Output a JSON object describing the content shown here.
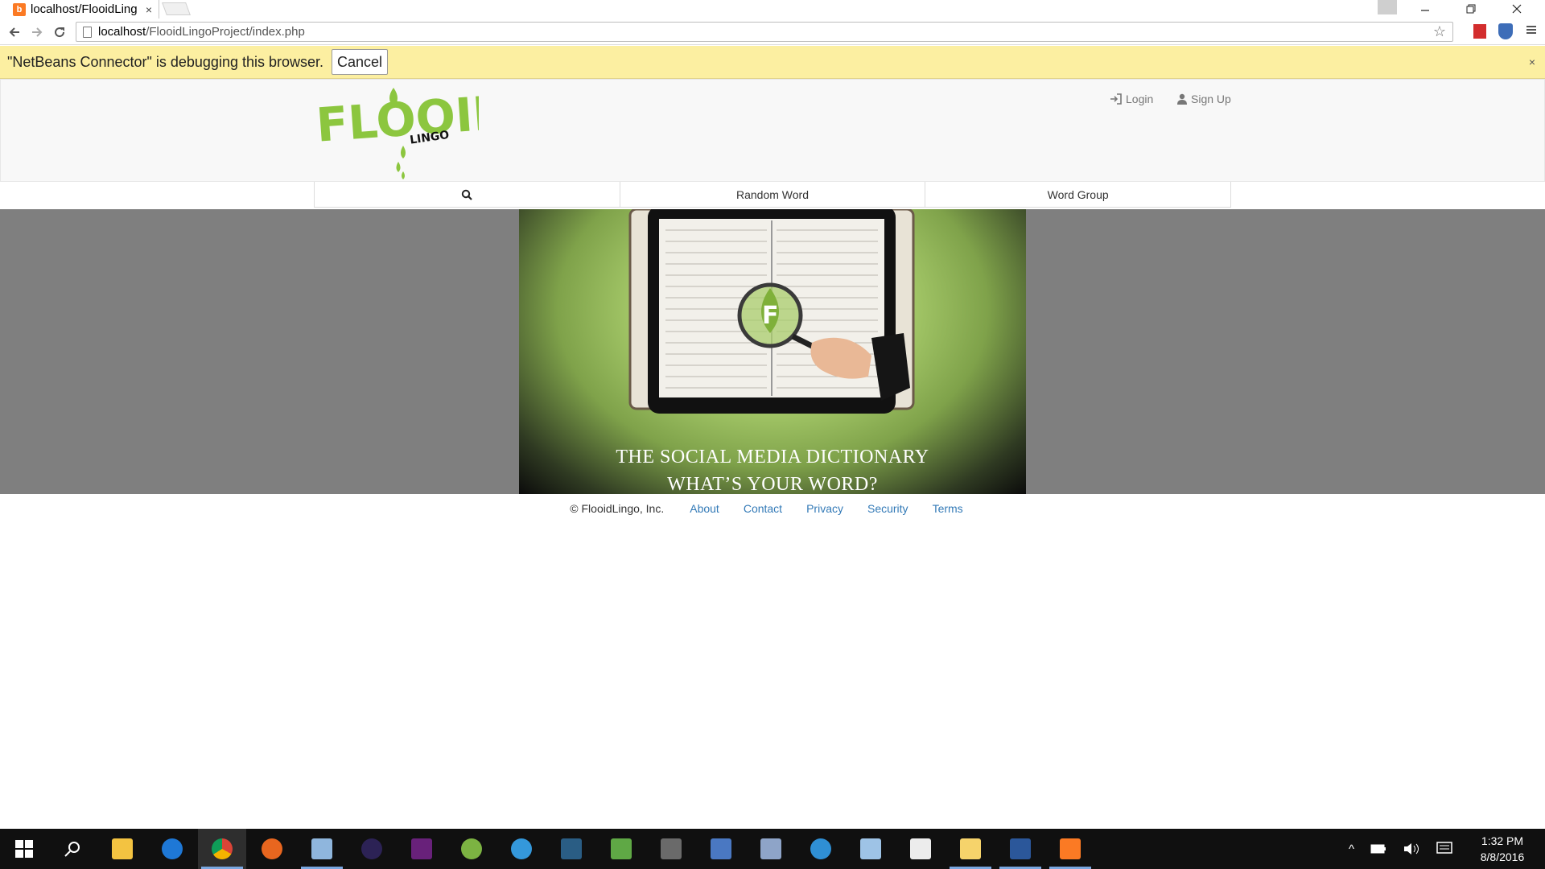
{
  "browser": {
    "tab_title": "localhost/FlooidLing",
    "tab_close": "×",
    "favicon_letter": "b",
    "address_host": "localhost",
    "address_path": "/FlooidLingoProject/index.php",
    "icons": [
      "back-icon",
      "forward-icon",
      "reload-icon",
      "page-icon",
      "star-icon",
      "menu-icon"
    ]
  },
  "infobar": {
    "message": "\"NetBeans Connector\" is debugging this browser.",
    "cancel_label": "Cancel",
    "close": "×"
  },
  "site": {
    "logo_text": "FLOOID",
    "logo_sub": "LINGO",
    "login_label": "Login",
    "signup_label": "Sign Up",
    "nav": [
      "",
      "Random Word",
      "Word Group"
    ],
    "hero_line1": "THE SOCIAL MEDIA DICTIONARY",
    "hero_line2": "WHAT’S YOUR WORD?",
    "colors": {
      "brand_green": "#8cc63f",
      "link_blue": "#337ab7",
      "band_gray": "#7f7f7f"
    }
  },
  "footer": {
    "copyright": "© FlooidLingo, Inc.",
    "links": [
      "About",
      "Contact",
      "Privacy",
      "Security",
      "Terms"
    ]
  },
  "taskbar": {
    "time": "1:32 PM",
    "date": "8/8/2016",
    "apps": [
      "start-icon",
      "search-icon",
      "file-explorer-icon",
      "edge-icon",
      "chrome-icon",
      "firefox-icon",
      "virtualbox-icon",
      "eclipse-icon",
      "visual-studio-icon",
      "android-studio-icon",
      "xamarin-icon",
      "mysql-workbench-icon",
      "notepad-icon",
      "vmware-icon",
      "network-icon",
      "device-icon",
      "sync-icon",
      "tablet-icon",
      "calculator-icon",
      "folder-icon",
      "word-icon",
      "xampp-icon"
    ]
  }
}
